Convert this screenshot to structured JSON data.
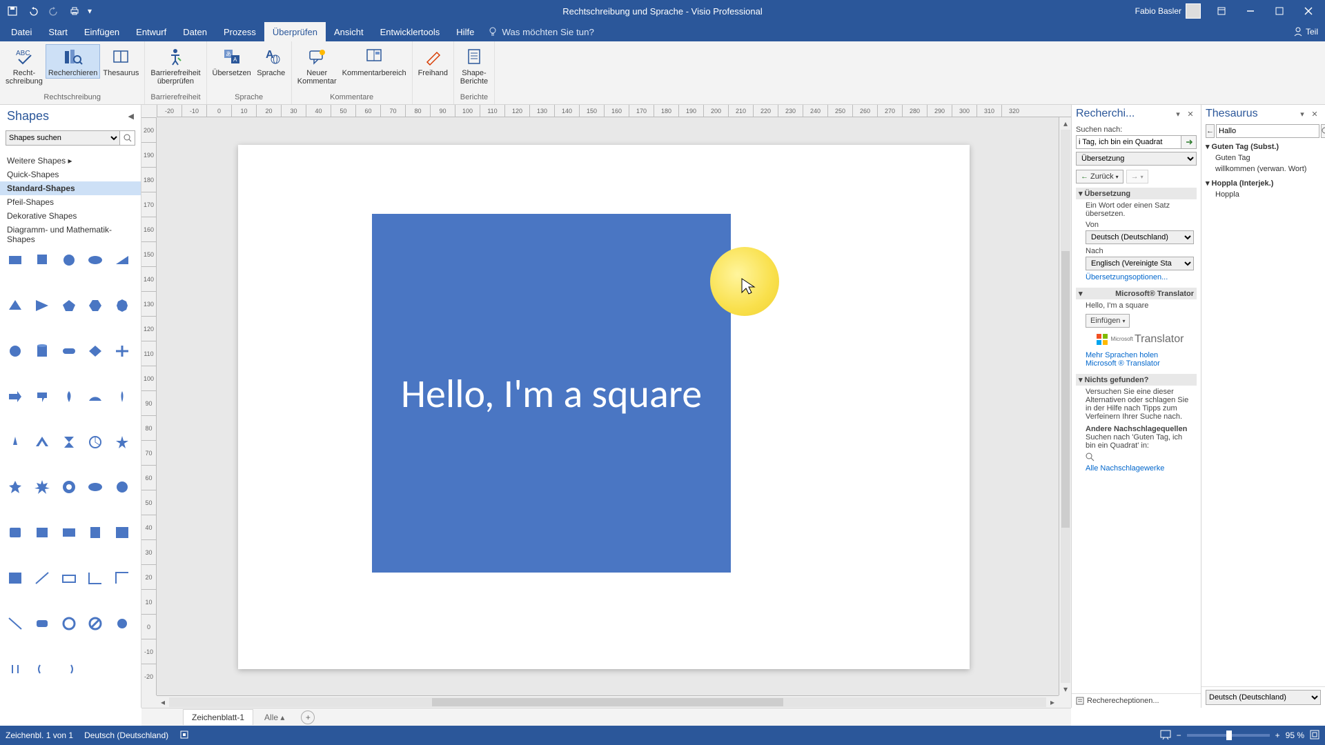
{
  "title": "Rechtschreibung und Sprache  -  Visio Professional",
  "user": "Fabio Basler",
  "tabs": {
    "file": "Datei",
    "start": "Start",
    "einfuegen": "Einfügen",
    "entwurf": "Entwurf",
    "daten": "Daten",
    "prozess": "Prozess",
    "ueberpruefen": "Überprüfen",
    "ansicht": "Ansicht",
    "entwicklertools": "Entwicklertools",
    "hilfe": "Hilfe"
  },
  "tellme_placeholder": "Was möchten Sie tun?",
  "share_label": "Teil",
  "ribbon": {
    "groups": {
      "rechtschreibung": "Rechtschreibung",
      "barrierefreiheit": "Barrierefreiheit",
      "sprache": "Sprache",
      "kommentare": "Kommentare",
      "freihand": "",
      "berichte": "Berichte"
    },
    "buttons": {
      "rechtschreibung": "Recht-\nschreibung",
      "recherchieren": "Recherchieren",
      "thesaurus": "Thesaurus",
      "barrierefreiheit": "Barrierefreiheit\nüberprüfen",
      "uebersetzen": "Übersetzen",
      "sprache": "Sprache",
      "neuer_kommentar": "Neuer\nKommentar",
      "kommentarbereich": "Kommentarbereich",
      "freihand": "Freihand",
      "shape_berichte": "Shape-\nBerichte"
    }
  },
  "shapes": {
    "title": "Shapes",
    "search_label": "Shapes suchen",
    "categories": {
      "weitere": "Weitere Shapes",
      "quick": "Quick-Shapes",
      "standard": "Standard-Shapes",
      "pfeil": "Pfeil-Shapes",
      "dekorative": "Dekorative Shapes",
      "diagramm": "Diagramm- und Mathematik-Shapes"
    }
  },
  "canvas": {
    "square_text": "Hello, I'm a square"
  },
  "research": {
    "title": "Recherchi...",
    "search_label": "Suchen nach:",
    "search_value": "i Tag, ich bin ein Quadrat",
    "source_value": "Übersetzung",
    "back": "Zurück",
    "translation_head": "Übersetzung",
    "translation_desc": "Ein Wort oder einen Satz übersetzen.",
    "from_label": "Von",
    "from_value": "Deutsch (Deutschland)",
    "to_label": "Nach",
    "to_value": "Englisch (Vereinigte Sta",
    "options_link": "Übersetzungsoptionen...",
    "translator_head": "Microsoft® Translator",
    "translated_text": "Hello, I'm a square",
    "insert_btn": "Einfügen",
    "translator_brand": "Translator",
    "translator_brand_prefix": "Microsoft",
    "more_langs": "Mehr Sprachen holen",
    "ms_translator_link": "Microsoft ® Translator",
    "notfound_head": "Nichts gefunden?",
    "notfound_text": "Versuchen Sie eine dieser Alternativen oder schlagen Sie in der Hilfe nach Tipps zum Verfeinern Ihrer Suche nach.",
    "other_sources_head": "Andere Nachschlagequellen",
    "other_sources_text": "Suchen nach 'Guten Tag, ich bin ein Quadrat' in:",
    "all_refs": "Alle Nachschlagewerke",
    "footer": "Recherecheptionen..."
  },
  "thesaurus": {
    "title": "Thesaurus",
    "search_value": "Hallo",
    "group1_head": "Guten Tag (Subst.)",
    "group1_items": [
      "Guten Tag",
      "willkommen (verwan. Wort)"
    ],
    "group2_head": "Hoppla (Interjek.)",
    "group2_items": [
      "Hoppla"
    ],
    "footer_lang": "Deutsch (Deutschland)"
  },
  "sheet": {
    "tab1": "Zeichenblatt-1",
    "all": "Alle"
  },
  "status": {
    "page_info": "Zeichenbl. 1 von 1",
    "lang": "Deutsch (Deutschland)",
    "zoom": "95 %"
  },
  "ruler_h": [
    -20,
    -10,
    0,
    10,
    20,
    30,
    40,
    50,
    60,
    70,
    80,
    90,
    100,
    110,
    120,
    130,
    140,
    150,
    160,
    170,
    180,
    190,
    200,
    210,
    220,
    230,
    240,
    250,
    260,
    270,
    280,
    290,
    300,
    310,
    320
  ],
  "ruler_v": [
    200,
    190,
    180,
    170,
    160,
    150,
    140,
    130,
    120,
    110,
    100,
    90,
    80,
    70,
    60,
    50,
    40,
    30,
    20,
    10,
    0,
    -10,
    -20
  ]
}
